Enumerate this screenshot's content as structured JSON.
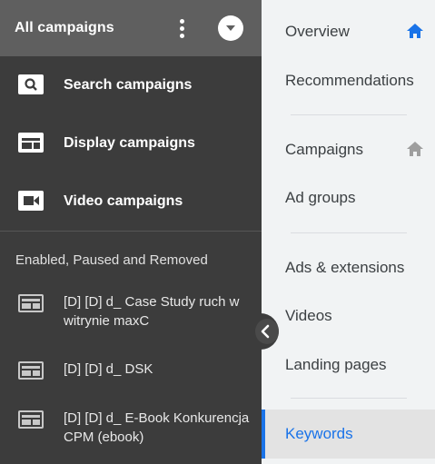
{
  "left_panel": {
    "header_title": "All campaigns",
    "campaign_types": [
      {
        "label": "Search campaigns",
        "icon": "search-icon"
      },
      {
        "label": "Display campaigns",
        "icon": "display-icon"
      },
      {
        "label": "Video campaigns",
        "icon": "video-icon"
      }
    ],
    "filter_label": "Enabled, Paused and Removed",
    "campaigns": [
      {
        "label": "[D] [D] d_ Case Study ruch w witrynie maxC",
        "icon": "display-icon"
      },
      {
        "label": "[D] [D] d_ DSK",
        "icon": "display-icon"
      },
      {
        "label": "[D] [D] d_ E-Book Konkurencja CPM (ebook)",
        "icon": "display-icon"
      }
    ]
  },
  "right_nav": {
    "items": [
      {
        "label": "Overview",
        "home_icon": "blue"
      },
      {
        "label": "Recommendations"
      },
      {
        "label": "Campaigns",
        "home_icon": "grey"
      },
      {
        "label": "Ad groups"
      },
      {
        "label": "Ads & extensions"
      },
      {
        "label": "Videos"
      },
      {
        "label": "Landing pages"
      },
      {
        "label": "Keywords",
        "active": true
      }
    ]
  },
  "colors": {
    "accent": "#1a73e8",
    "dark_panel": "#3c3c3c",
    "header": "#5f5f5f"
  }
}
